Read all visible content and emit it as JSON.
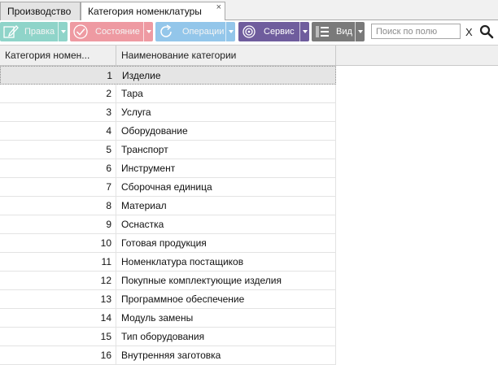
{
  "tabs": [
    {
      "label": "Производство",
      "active": false
    },
    {
      "label": "Категория номенклатуры",
      "active": true,
      "close": "×"
    }
  ],
  "toolbar": {
    "edit": {
      "label": "Правка",
      "icon": "edit-icon",
      "color": "#8fd4c9"
    },
    "state": {
      "label": "Состояние",
      "icon": "check-circle-icon",
      "color": "#ee9aa2"
    },
    "ops": {
      "label": "Операции",
      "icon": "refresh-icon",
      "color": "#93c6ea"
    },
    "service": {
      "label": "Сервис",
      "icon": "gear-icon",
      "color": "#6f5d9d"
    },
    "view": {
      "label": "Вид",
      "icon": "list-view-icon",
      "color": "#7a7a7a"
    },
    "search": {
      "placeholder": "Поиск по полю",
      "value": "",
      "clear": "X",
      "icon": "magnifier-icon"
    }
  },
  "grid": {
    "columns": [
      "Категория номен...",
      "Наименование категории"
    ],
    "rows": [
      {
        "id": "1",
        "name": "Изделие"
      },
      {
        "id": "2",
        "name": "Тара"
      },
      {
        "id": "3",
        "name": "Услуга"
      },
      {
        "id": "4",
        "name": "Оборудование"
      },
      {
        "id": "5",
        "name": "Транспорт"
      },
      {
        "id": "6",
        "name": "Инструмент"
      },
      {
        "id": "7",
        "name": "Сборочная единица"
      },
      {
        "id": "8",
        "name": "Материал"
      },
      {
        "id": "9",
        "name": "Оснастка"
      },
      {
        "id": "10",
        "name": "Готовая продукция"
      },
      {
        "id": "11",
        "name": "Номенклатура постащиков"
      },
      {
        "id": "12",
        "name": "Покупные комплектующие изделия"
      },
      {
        "id": "13",
        "name": "Программное обеспечение"
      },
      {
        "id": "14",
        "name": "Модуль замены"
      },
      {
        "id": "15",
        "name": "Тип оборудования"
      },
      {
        "id": "16",
        "name": "Внутренняя заготовка"
      }
    ],
    "selected_index": 0
  }
}
